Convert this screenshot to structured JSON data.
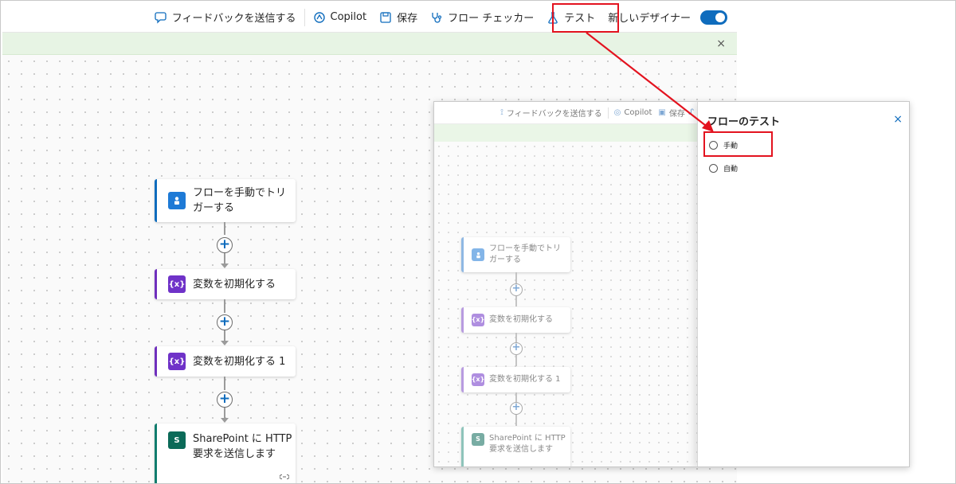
{
  "toolbar": {
    "feedback": "フィードバックを送信する",
    "copilot": "Copilot",
    "save": "保存",
    "flow_checker": "フロー チェッカー",
    "test": "テスト",
    "new_designer": "新しいデザイナー",
    "new_designer_on": true
  },
  "banner": {
    "close": "×"
  },
  "flow": {
    "trigger": "フローを手動でトリガーする",
    "trigger_line1": "フローを手動でトリ",
    "trigger_line2": "ガーする",
    "init_var": "変数を初期化する",
    "init_var_1": "変数を初期化する 1",
    "sharepoint_line1": "SharePoint に HTTP",
    "sharepoint_line2": "要求を送信します",
    "var_icon": "{x}",
    "sp_icon": "S"
  },
  "inset_toolbar": {
    "feedback": "フィードバックを送信する",
    "copilot": "Copilot",
    "save": "保存"
  },
  "test_panel": {
    "title": "フローのテスト",
    "close": "×",
    "options": [
      "手動",
      "自動"
    ]
  },
  "colors": {
    "accent": "#0f6cbd",
    "highlight": "#e3131f",
    "banner": "#e7f4e4"
  }
}
